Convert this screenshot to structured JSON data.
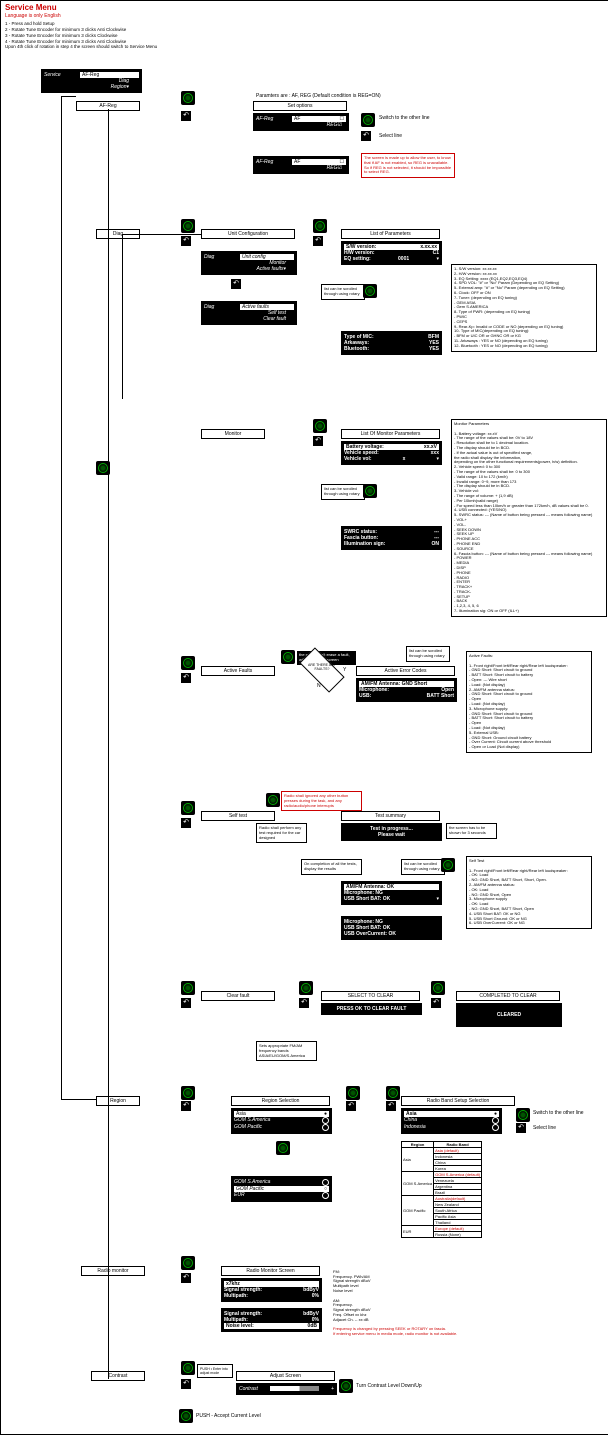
{
  "title": "Service Menu",
  "lang": "Language is only English",
  "instructions": [
    "1 - Press and hold Setup",
    "2 - Rotate Tune Encoder for minimum 3 clicks Anti Clockwise",
    "3 - Rotate Tune Encoder for minimum 3 clicks Clockwise",
    "4 - Rotate Tune Encoder for minimum 3 clicks Anti Clockwise",
    "Upon 4th click of rotation in step 4 the screen should switch to Service Menu"
  ],
  "svc": {
    "title": "Service",
    "i1": "AF-Reg",
    "i2": "Diag",
    "i3": "Region"
  },
  "afreg": {
    "hdr": "AF-Reg",
    "set": "Set options",
    "params": "Paramters are : AF, REG (Default condition is REG=ON)",
    "af": "AF",
    "reg": "REG",
    "sw": "Switch to the other line",
    "sel": "Select line",
    "warn": "The screen is made up to allow the user, to know that if AF is not enabled, so REG is unavailable.\nSo if REG is not selected, it should be impossible to select REG."
  },
  "diag": {
    "hdr": "Diag",
    "uc": "Unit Configuration",
    "lop": "List of Parameters",
    "d1": "Unit config",
    "d2": "Monitor",
    "d3": "Active faults",
    "af": "Active faults",
    "st": "Self test",
    "cf": "Clear fault"
  },
  "lop": {
    "sw": "S/W version:",
    "swv": "x.xx.xx",
    "hw": "H/W version:",
    "hwv": "C1",
    "eq": "EQ setting:",
    "eqv": "0001",
    "mic": "Type of MIC:",
    "micv": "BFM",
    "ark": "Arkaways:",
    "arkv": "YES",
    "bt": "Bluetooth:",
    "btv": "YES",
    "scroll": "list can be scrolled through using rotary"
  },
  "lopnote": [
    "1- S/W version: xx.xx.xx",
    "2- H/W version: xx.xx.xx",
    "3- EQ Setting: xxxx (EQ1,EQ2,EQ3,EQ4)",
    "4- SPD VOL: \"#\" or \"No\" Param (Depending on EQ Setting)",
    "5- External amp: \"#\" or \"No\" Param (depending on EQ Setting)",
    "6- Clock: OFF or ON",
    "7- Tuner: (depending on EQ tuning)",
    "  - GEM ASIA",
    "  - Gem S.AMERICA",
    "8- Type of PWR: (depending on EQ tuning)",
    "  - PWIC",
    "  - CEPS",
    "9- Rear-Kp: Invalid or CODE or NO (depending on EQ tuning)",
    "10- Type of MIC(depending on EQ tuning):",
    "  - BFM or UIC OR or GHNC OR or KG",
    "11- Arkaways : YES or NO (depending on EQ tuning)",
    "12- Bluetooth : YES or NO (depending on EQ tuning)"
  ],
  "mon": {
    "hdr": "Monitor",
    "lp": "List Of Monitor Parameters",
    "bv": "Battery voltage:",
    "bvv": "xx.xV",
    "vs": "Vehicle speed:",
    "vsv": "xxx",
    "vv": "Vehicle vol:",
    "vvv": "x",
    "swrc": "SWRC status:",
    "swrcv": "---",
    "fb": "Fascia button:",
    "fbv": "---",
    "ill": "Illumination sign:",
    "illv": "ON"
  },
  "monnote": "Monitor Parameters\n\n1- Battery voltage: xx.xV\n - The range of the values shall be: 0V to 18V\n - Resolution shall be to 1 decimal location.\n - The display should be in BCD.\n - If the actual value is out of specified range,\n   the radio shall display the information,\n   depending on the other functional requirements(power, h/w) definition.\n2- Vehicle speed: 0 to 300\n - The range of the values shall be: 0 to 300\n - Valid range: 10 to 172 (km/h)\n - Invalid range: 0~9, more than 173\n - The display should be in BCD.\n3- Vehicle vol:\n - The range of volume: + (1,9 dB)\n - Per 10kmh(valid range)\n - For speed less than 10km/h or greater than 172km/h, dB values shall be 0.\n4- USB connected: (YES/NO)\n5- SWRC status: --- (Name of button being pressed --- means following name)\n - VOL+\n - VOL-\n - SEEK DOWN\n - SEEK UP\n - PHONE ACC\n - PHONE END\n - SOURCE\n6- Fascia button: --- (Name of button being pressed --- means following name)\n - POWER\n - MEDIA\n - DISP\n - PHONE\n - RADIO\n - ENTER\n - TRACK+\n - TRACK-\n - SETUP\n - BACK\n - 1,2,3, 4, 5, 6\n7- Illumination sig: ON or OFF (ILL+)",
  "af": {
    "hdr": "Active Faults",
    "aec": "Active Error Codes",
    "amfm": "AM/FM Antenna: GND Short",
    "mic": "Microphone:",
    "micv": "Open",
    "usb": "USB:",
    "usbv": "BATT Short",
    "dec": "ARE THERE ANY FAULTS?",
    "top": "the radio, don't erase a fault, will not change screen",
    "scroll": "list can be scrolled through using rotary"
  },
  "afnote": "Active Faults:\n\n1- Front right/Front left/Rear right/Rear left loudspeaker:\n - GND Short: Short circuit to ground\n - BATT Short: Short circuit to battery\n - Open: --- Wire short\n - Load: (Not display)\n2- AM/FM antenna status:\n - GND Short: Short circuit to ground\n - Open\n - Load: (Not display)\n3- Microphone supply:\n - GND Short: Short circuit to ground\n - BATT Short: Short circuit to battery\n - Open\n - Load: (Not display)\n5- External USB:\n - GND Short: Ground circuit battery\n - Over Current: Circuit current above threshold\n - Open or Load (Not display)",
  "st": {
    "hdr": "Self test",
    "ts": "Test summary",
    "prog": "Test in progress...",
    "wait": "Please wait",
    "res1": "AM/FM Antenna:  OK",
    "res2": "Microphone:         NG",
    "res3": "USB Short BAT:   OK",
    "res4": "Microphone:         NG",
    "res5": "USB Short BAT:   OK",
    "res6": "USB OverCurrent: OK",
    "n1": "Radio shall perform any test required for the car designed",
    "n2": "On completion of all the tests, display the results",
    "n3": "the screen has to be shown for 3 seconds",
    "red": "Radio shall ignored any other button presses during the task, and any radio/audio/phone interrupts"
  },
  "stnote": "Self Test\n\n1- Front right/Front left/Rear right/Rear left loudspeaker:\n - OK: Load\n - NG: GND Short, BATT Short, Short, Open.\n2- AM/FM antenna status:\n - OK: Load\n - NG: GND Short, Open\n3- Microphone supply\n - OK: Load\n - NG: GND Short, BATT Short, Open\n4- USB Short BAT: OK or NG\n5- USB Short Ground: OK or NG\n6- USB OverCurrent: OK or NG",
  "cf": {
    "hdr": "Clear fault",
    "sel": "SELECT TO CLEAR",
    "press": "PRESS OK TO CLEAR FAULT",
    "comp": "COMPLETED TO CLEAR",
    "cleared": "CLEARED"
  },
  "reg": {
    "hdr": "Region",
    "rs": "Region Selection",
    "asia": "Asia",
    "gs": "GOM S.America",
    "gp": "GOM Pacific",
    "eur": "EUR",
    "rbs": "Radio Band Setup Selection",
    "china": "China",
    "indo": "Indonesia",
    "sw": "Switch to the other line",
    "sel": "Select line",
    "note": "Sets appropriate FM/AM frequency bands ASIA/EU/GOM/S.America"
  },
  "rbtable": {
    "h1": "Region",
    "h2": "Radio Band",
    "rows": [
      [
        "Asia",
        "Asia (default)"
      ],
      [
        "",
        "Indonesia"
      ],
      [
        "",
        "China"
      ],
      [
        "",
        "Korea"
      ],
      [
        "GOM S.America",
        "GOM S.America (default)"
      ],
      [
        "",
        "Venezuela"
      ],
      [
        "",
        "Argentina"
      ],
      [
        "",
        "Brazil"
      ],
      [
        "GOM Pacific",
        "Australia(default)"
      ],
      [
        "",
        "New Zealand"
      ],
      [
        "",
        "South Africa"
      ],
      [
        "",
        "Pacific Asia"
      ],
      [
        "",
        "Thailand"
      ],
      [
        "EUR",
        "Europe (default)"
      ],
      [
        "",
        "Russia (None)"
      ]
    ]
  },
  "rm": {
    "hdr": "Radio monitor",
    "rms": "Radio Monitor Screen",
    "freq": "x7khz",
    "ss": "Signal strength:",
    "ssv": "bdByV",
    "mp": "Multipath:",
    "mpv": "0%",
    "nl": "Noise level:",
    "nlv": "0dB"
  },
  "rmnote": "FM:\nFrequency. PWh/AM\nSignal strength dBuV\nMultipath level\nNoise level\n\nAM:\nFrequency.\nSignal strength dBuV\nFreq. Offset xx khz\nAdjacet Ch. -- xx dB\n\nFrequency is changed by pressing SEEK or ROTARY on fascia.\nIf entering service menu in media mode, radio monitor is not available.",
  "con": {
    "hdr": "Contrast",
    "as": "Adjust Screen",
    "c": "Contrast",
    "turn": "Turn Contrast Level Down/Up",
    "push": "PUSH - Accept Current Level",
    "knob": "PUSH • Enter into adjust mode"
  }
}
